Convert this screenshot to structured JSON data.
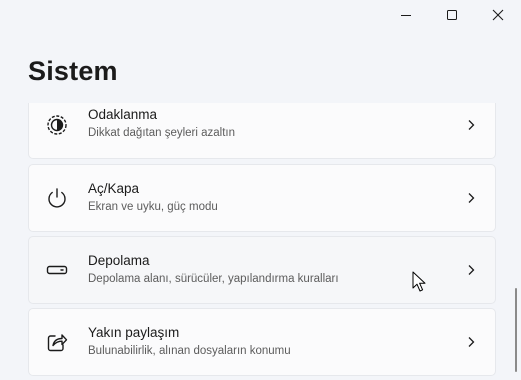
{
  "window": {
    "caption": {
      "minimize_icon": "minimize-icon",
      "maximize_icon": "maximize-icon",
      "close_icon": "close-icon"
    }
  },
  "page": {
    "title": "Sistem"
  },
  "items": [
    {
      "title": "Odaklanma",
      "subtitle": "Dikkat dağıtan şeyleri azaltın",
      "icon": "focus-icon"
    },
    {
      "title": "Aç/Kapa",
      "subtitle": "Ekran ve uyku, güç modu",
      "icon": "power-icon"
    },
    {
      "title": "Depolama",
      "subtitle": "Depolama alanı, sürücüler, yapılandırma kuralları",
      "icon": "storage-icon"
    },
    {
      "title": "Yakın paylaşım",
      "subtitle": "Bulunabilirlik, alınan dosyaların konumu",
      "icon": "share-icon"
    }
  ],
  "colors": {
    "background": "#f3f5f9",
    "card": "#fbfbfc",
    "text": "#1b1b1b",
    "subtext": "#5c5c5c"
  }
}
